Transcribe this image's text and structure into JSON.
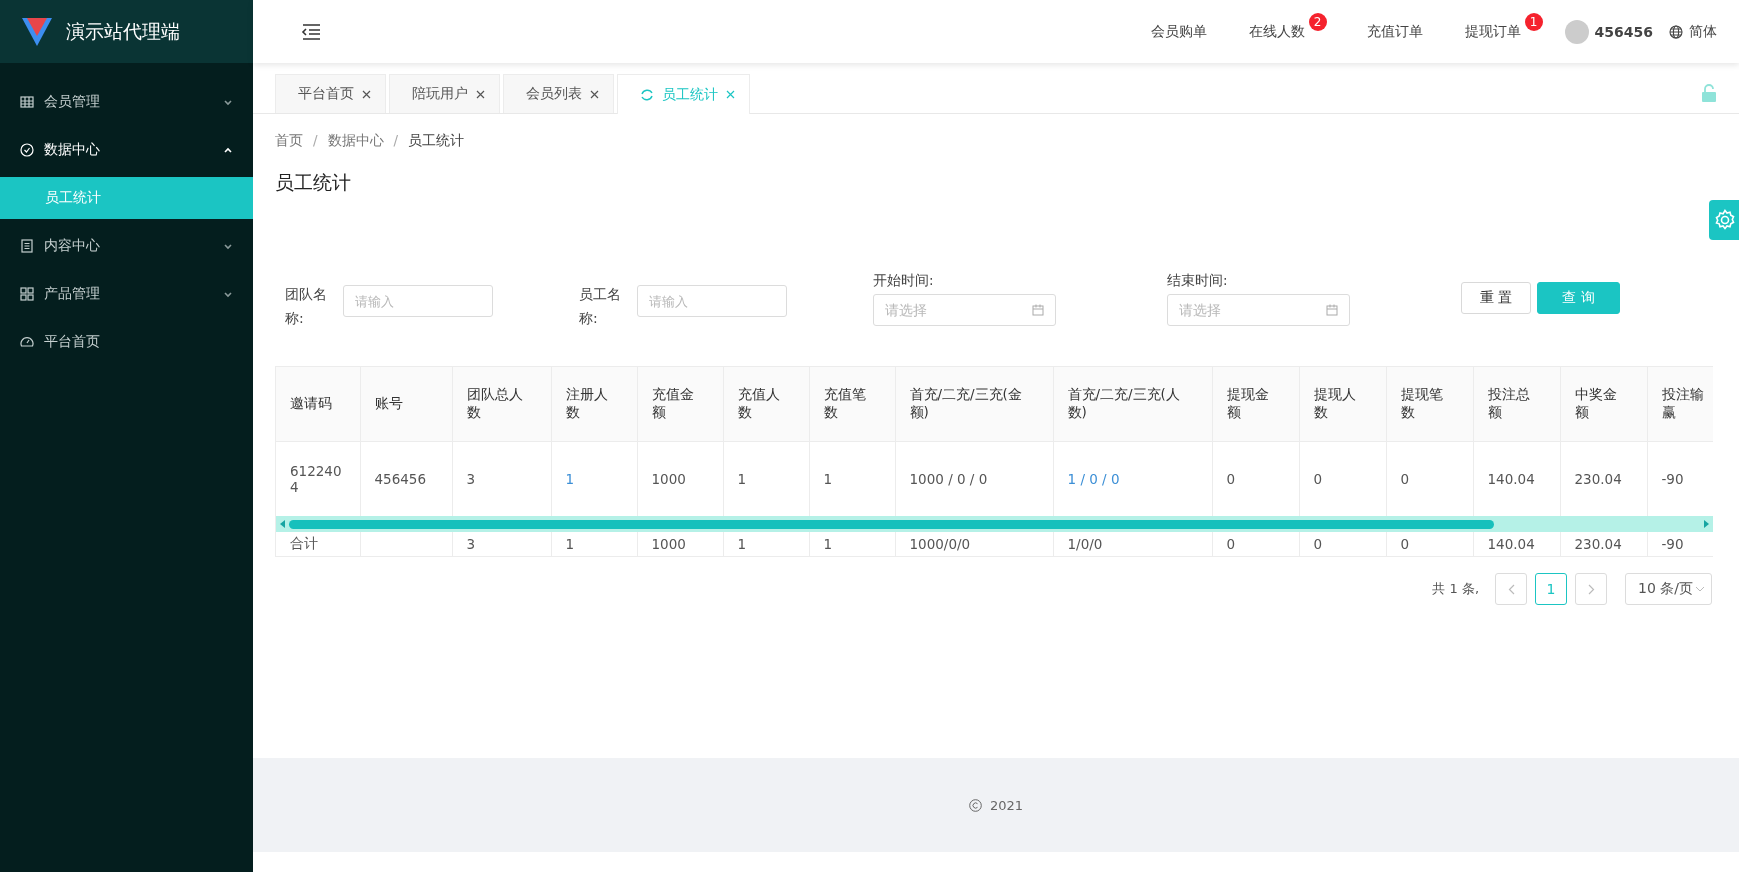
{
  "sidebar": {
    "title": "演示站代理端",
    "items": [
      {
        "label": "会员管理",
        "kind": "group",
        "expanded": false
      },
      {
        "label": "数据中心",
        "kind": "group",
        "expanded": true,
        "children": [
          {
            "label": "员工统计",
            "selected": true
          }
        ]
      },
      {
        "label": "内容中心",
        "kind": "group",
        "expanded": false
      },
      {
        "label": "产品管理",
        "kind": "group",
        "expanded": false
      },
      {
        "label": "平台首页",
        "kind": "link"
      }
    ]
  },
  "header": {
    "nav": [
      {
        "label": "会员购单"
      },
      {
        "label": "在线人数",
        "badge": "2"
      },
      {
        "label": "充值订单"
      },
      {
        "label": "提现订单",
        "badge": "1"
      }
    ],
    "user": "456456",
    "language": "简体"
  },
  "tabs": [
    {
      "label": "平台首页",
      "selected": false
    },
    {
      "label": "陪玩用户",
      "selected": false
    },
    {
      "label": "会员列表",
      "selected": false
    },
    {
      "label": "员工统计",
      "selected": true
    }
  ],
  "breadcrumb": {
    "separator": "/",
    "items": [
      "首页",
      "数据中心",
      "员工统计"
    ]
  },
  "page_title": "员工统计",
  "filters": [
    {
      "label": "团队名称:",
      "kind": "text",
      "placeholder": "请输入"
    },
    {
      "label": "员工名称:",
      "kind": "text",
      "placeholder": "请输入"
    },
    {
      "label": "开始时间:",
      "kind": "date",
      "placeholder": "请选择"
    },
    {
      "label": "结束时间:",
      "kind": "date",
      "placeholder": "请选择"
    }
  ],
  "buttons": [
    {
      "label": "重 置",
      "kind": "plain"
    },
    {
      "label": "查 询",
      "kind": "primary"
    }
  ],
  "table": {
    "columns": [
      "邀请码",
      "账号",
      "团队总人数",
      "注册人数",
      "充值金额",
      "充值人数",
      "充值笔数",
      "首充/二充/三充(金额)",
      "首充/二充/三充(人数)",
      "提现金额",
      "提现人数",
      "提现笔数",
      "投注总额",
      "中奖金额",
      "投注输赢"
    ],
    "rows": [
      [
        {
          "text": "6122404",
          "link": false
        },
        {
          "text": "456456",
          "link": false
        },
        {
          "text": "3",
          "link": false
        },
        {
          "text": "1",
          "link": true
        },
        {
          "text": "1000",
          "link": false
        },
        {
          "text": "1",
          "link": false
        },
        {
          "text": "1",
          "link": false
        },
        {
          "text": "1000 / 0 / 0",
          "link": false
        },
        {
          "text": "1 / 0 / 0",
          "link": true
        },
        {
          "text": "0",
          "link": false
        },
        {
          "text": "0",
          "link": false
        },
        {
          "text": "0",
          "link": false
        },
        {
          "text": "140.04",
          "link": false
        },
        {
          "text": "230.04",
          "link": false
        },
        {
          "text": "-90",
          "link": false
        }
      ]
    ],
    "totals": {
      "label": "合计",
      "values": [
        "3",
        "1",
        "1000",
        "1",
        "1",
        "1000/0/0",
        "1/0/0",
        "0",
        "0",
        "0",
        "140.04",
        "230.04",
        "-90"
      ]
    }
  },
  "pagination": {
    "total": "共 1 条,",
    "pages": [
      {
        "label": "1",
        "selected": true
      }
    ],
    "page_size": "10 条/页"
  },
  "footer": "2021"
}
